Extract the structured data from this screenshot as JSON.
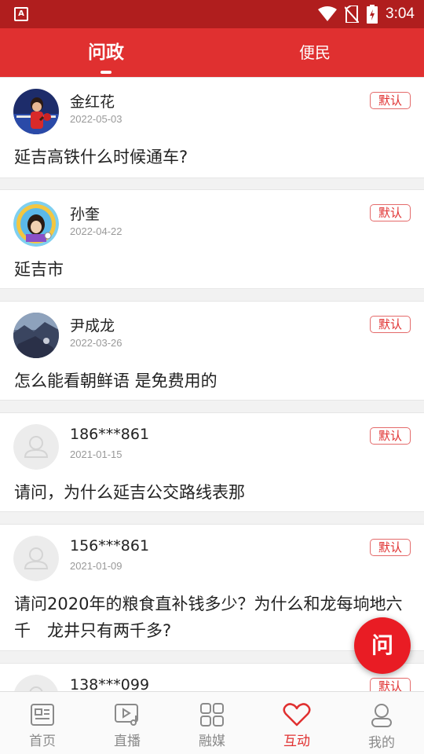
{
  "status_bar": {
    "app_letter": "A",
    "time": "3:04"
  },
  "top_tabs": [
    {
      "label": "问政",
      "active": true
    },
    {
      "label": "便民",
      "active": false
    }
  ],
  "posts": [
    {
      "user": "金红花",
      "date": "2022-05-03",
      "badge": "默认",
      "text": "延吉高铁什么时候通车?",
      "avatar": "photo-table-tennis"
    },
    {
      "user": "孙奎",
      "date": "2022-04-22",
      "badge": "默认",
      "text": "延吉市",
      "avatar": "photo-cartoon"
    },
    {
      "user": "尹成龙",
      "date": "2022-03-26",
      "badge": "默认",
      "text": "怎么能看朝鲜语 是免费用的",
      "avatar": "photo-landscape"
    },
    {
      "user": "186***861",
      "date": "2021-01-15",
      "badge": "默认",
      "text": "请问，为什么延吉公交路线表那",
      "avatar": "default-user"
    },
    {
      "user": "156***861",
      "date": "2021-01-09",
      "badge": "默认",
      "text": "请问2020年的粮食直补钱多少？为什么和龙每垧地六千　龙井只有两千多?",
      "avatar": "default-user"
    },
    {
      "user": "138***099",
      "date": "",
      "badge": "默认",
      "text": "",
      "avatar": "default-user"
    }
  ],
  "fab": {
    "label": "问"
  },
  "bottom_nav": [
    {
      "label": "首页",
      "icon": "news-icon",
      "active": false
    },
    {
      "label": "直播",
      "icon": "live-video-icon",
      "active": false
    },
    {
      "label": "融媒",
      "icon": "grid-icon",
      "active": false
    },
    {
      "label": "互动",
      "icon": "heart-icon",
      "active": true
    },
    {
      "label": "我的",
      "icon": "user-icon",
      "active": false
    }
  ],
  "colors": {
    "status_bar": "#b01e1e",
    "header": "#e03030",
    "accent": "#e91c24",
    "nav_inactive": "#8a8a8a"
  }
}
